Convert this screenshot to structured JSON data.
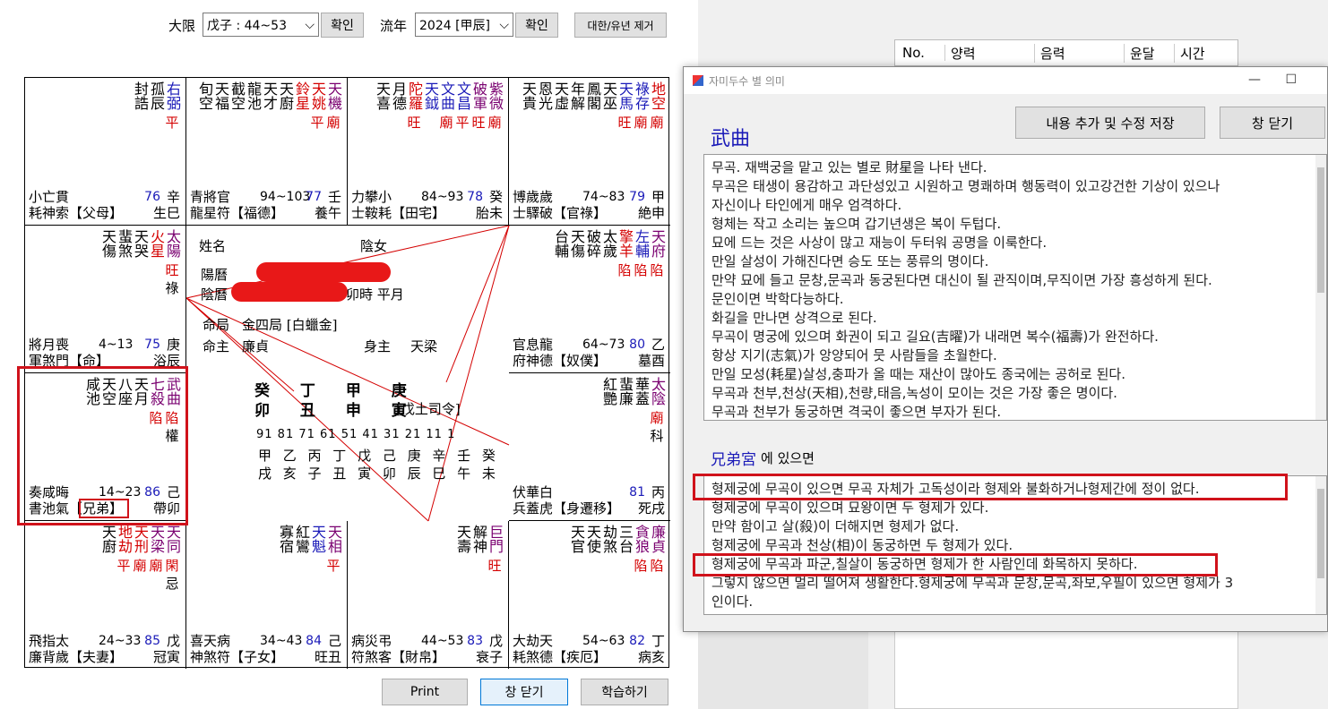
{
  "top": {
    "daehan_label": "大限",
    "daehan_value": "戊子 : 44~53",
    "confirm1": "확인",
    "yunyeon_label": "流年",
    "yunyeon_value": "2024 [甲辰]",
    "confirm2": "확인",
    "remove": "대한/유년 제거"
  },
  "cells": [
    {
      "id": "si",
      "stars": [
        {
          "n": "右弼",
          "c": "blue",
          "st": "平",
          "stc": "red"
        },
        {
          "n": "孤辰",
          "c": "black"
        },
        {
          "n": "封誥",
          "c": "black"
        }
      ],
      "bot_l1": "小亡貫",
      "bot_l2": "耗神索【父母】",
      "age": "",
      "num": "76",
      "gz1": "辛",
      "gz2": "生巳"
    },
    {
      "id": "o",
      "stars": [
        {
          "n": "天機",
          "c": "purple",
          "st": "廟",
          "stc": "red"
        },
        {
          "n": "天姚",
          "c": "red",
          "st": "平",
          "stc": "red"
        },
        {
          "n": "鈴星",
          "c": "red"
        },
        {
          "n": "天廚",
          "c": "black"
        },
        {
          "n": "天才",
          "c": "black"
        },
        {
          "n": "龍池",
          "c": "black"
        },
        {
          "n": "截空",
          "c": "black"
        },
        {
          "n": "天福",
          "c": "black"
        },
        {
          "n": "旬空",
          "c": "black"
        }
      ],
      "bot_l1": "青將官",
      "bot_l2": "龍星符【福德】",
      "age": "94~103",
      "num": "77",
      "gz1": "壬",
      "gz2": "養午"
    },
    {
      "id": "mi",
      "stars": [
        {
          "n": "紫微",
          "c": "purple",
          "st": "廟",
          "stc": "red"
        },
        {
          "n": "破軍",
          "c": "purple",
          "st": "旺",
          "stc": "red"
        },
        {
          "n": "文昌",
          "c": "blue",
          "st": "平",
          "stc": "red"
        },
        {
          "n": "文曲",
          "c": "blue",
          "st": "廟",
          "stc": "red"
        },
        {
          "n": "天鉞",
          "c": "blue"
        },
        {
          "n": "陀羅",
          "c": "red",
          "st": "旺",
          "stc": "red"
        },
        {
          "n": "月德",
          "c": "black"
        },
        {
          "n": "天喜",
          "c": "black"
        }
      ],
      "bot_l1": "力攀小",
      "bot_l2": "士鞍耗【田宅】",
      "age": "84~93",
      "num": "78",
      "gz1": "癸",
      "gz2": "胎未"
    },
    {
      "id": "sin",
      "stars": [
        {
          "n": "地空",
          "c": "red",
          "st": "廟",
          "stc": "red"
        },
        {
          "n": "祿存",
          "c": "blue",
          "st": "廟",
          "stc": "red"
        },
        {
          "n": "天馬",
          "c": "blue",
          "st": "旺",
          "stc": "red"
        },
        {
          "n": "天巫",
          "c": "black"
        },
        {
          "n": "鳳閣",
          "c": "black"
        },
        {
          "n": "年解",
          "c": "black"
        },
        {
          "n": "天虛",
          "c": "black"
        },
        {
          "n": "恩光",
          "c": "black"
        },
        {
          "n": "天貴",
          "c": "black"
        }
      ],
      "bot_l1": "博歲歲",
      "bot_l2": "士驛破【官祿】",
      "age": "74~83",
      "num": "79",
      "gz1": "甲",
      "gz2": "絶申"
    },
    {
      "id": "jin",
      "stars": [
        {
          "n": "太陽",
          "c": "purple",
          "st": "旺",
          "stc": "red",
          "ex": "祿",
          "exc": "black"
        },
        {
          "n": "火星",
          "c": "red"
        },
        {
          "n": "天哭",
          "c": "black"
        },
        {
          "n": "蜚煞",
          "c": "black"
        },
        {
          "n": "天傷",
          "c": "black"
        }
      ],
      "bot_l1": "將月喪",
      "bot_l2": "軍煞門【命】",
      "age": "4~13",
      "num": "75",
      "gz1": "庚",
      "gz2": "浴辰"
    },
    {
      "id": "yu",
      "stars": [
        {
          "n": "天府",
          "c": "purple",
          "st": "陷",
          "stc": "red"
        },
        {
          "n": "左輔",
          "c": "blue",
          "st": "陷",
          "stc": "red"
        },
        {
          "n": "擎羊",
          "c": "red",
          "st": "陷",
          "stc": "red"
        },
        {
          "n": "太歲",
          "c": "black"
        },
        {
          "n": "破碎",
          "c": "black"
        },
        {
          "n": "天傷",
          "c": "black"
        },
        {
          "n": "台輔",
          "c": "black"
        }
      ],
      "bot_l1": "官息龍",
      "bot_l2": "府神德【奴僕】",
      "age": "64~73",
      "num": "80",
      "gz1": "乙",
      "gz2": "墓酉"
    },
    {
      "id": "myo",
      "stars": [
        {
          "n": "武曲",
          "c": "purple",
          "st": "陷",
          "stc": "red",
          "ex": "權",
          "exc": "black"
        },
        {
          "n": "七殺",
          "c": "purple",
          "st": "陷",
          "stc": "red"
        },
        {
          "n": "天月",
          "c": "black"
        },
        {
          "n": "八座",
          "c": "black"
        },
        {
          "n": "天空",
          "c": "black"
        },
        {
          "n": "咸池",
          "c": "black"
        }
      ],
      "bot_l1": "奏咸晦",
      "bot_l2": "書池氣【兄弟】",
      "age": "14~23",
      "num": "86",
      "gz1": "己",
      "gz2": "帶卯"
    },
    {
      "id": "sul",
      "stars": [
        {
          "n": "太陰",
          "c": "purple",
          "st": "廟",
          "stc": "red",
          "ex": "科",
          "exc": "black"
        },
        {
          "n": "華蓋",
          "c": "black"
        },
        {
          "n": "蜚廉",
          "c": "black"
        },
        {
          "n": "紅艷",
          "c": "black"
        }
      ],
      "bot_l1": "伏華白",
      "bot_l2": "兵蓋虎【身遷移】",
      "age": "",
      "num": "81",
      "gz1": "丙",
      "gz2": "死戌"
    },
    {
      "id": "in",
      "stars": [
        {
          "n": "天同",
          "c": "purple",
          "st": "閑",
          "stc": "red",
          "ex": "忌",
          "exc": "black"
        },
        {
          "n": "天梁",
          "c": "purple",
          "st": "廟",
          "stc": "red"
        },
        {
          "n": "天刑",
          "c": "red",
          "st": "廟",
          "stc": "red"
        },
        {
          "n": "地劫",
          "c": "red",
          "st": "平",
          "stc": "red"
        },
        {
          "n": "天廚",
          "c": "black"
        }
      ],
      "bot_l1": "飛指太",
      "bot_l2": "廉背歲【夫妻】",
      "age": "24~33",
      "num": "85",
      "gz1": "戊",
      "gz2": "冠寅"
    },
    {
      "id": "chuk",
      "stars": [
        {
          "n": "天相",
          "c": "purple",
          "st": "平",
          "stc": "red"
        },
        {
          "n": "天魁",
          "c": "blue"
        },
        {
          "n": "紅鸞",
          "c": "black"
        },
        {
          "n": "寡宿",
          "c": "black"
        }
      ],
      "bot_l1": "喜天病",
      "bot_l2": "神煞符【子女】",
      "age": "34~43",
      "num": "84",
      "gz1": "己",
      "gz2": "旺丑"
    },
    {
      "id": "ja",
      "stars": [
        {
          "n": "巨門",
          "c": "purple",
          "st": "旺",
          "stc": "red"
        },
        {
          "n": "解神",
          "c": "black"
        },
        {
          "n": "天壽",
          "c": "black"
        }
      ],
      "bot_l1": "病災弔",
      "bot_l2": "符煞客【財帛】",
      "age": "44~53",
      "num": "83",
      "gz1": "戊",
      "gz2": "衰子"
    },
    {
      "id": "hae",
      "stars": [
        {
          "n": "廉貞",
          "c": "purple",
          "st": "陷",
          "stc": "red"
        },
        {
          "n": "貪狼",
          "c": "purple",
          "st": "陷",
          "stc": "red"
        },
        {
          "n": "三台",
          "c": "black"
        },
        {
          "n": "劫煞",
          "c": "black"
        },
        {
          "n": "天使",
          "c": "black"
        },
        {
          "n": "天官",
          "c": "black"
        }
      ],
      "bot_l1": "大劫天",
      "bot_l2": "耗煞德【疾厄】",
      "age": "54~63",
      "num": "82",
      "gz1": "丁",
      "gz2": "病亥"
    }
  ],
  "center": {
    "name_label": "姓名",
    "gender": "陰女",
    "yang_label": "陽曆",
    "eum_label": "陰曆",
    "time_text": "卯時 平月",
    "myeongguk_label": "命局",
    "myeongguk": "金四局 [白蠟金]",
    "myeongju_label": "命主",
    "myeongju": "廉貞",
    "sinju_label": "身主",
    "sinju": "天梁",
    "pillars_top": "癸 丁 甲 庚",
    "pillars_bot": "卯 丑 申 寅",
    "saryeong": "[戊土司令]",
    "dw_ages": "91 81 71 61 51 41 31 21 11 1",
    "dw_top": "甲 乙 丙 丁 戊 己 庚 辛 壬 癸",
    "dw_bot": "戌 亥 子 丑 寅 卯 辰 巳 午 未"
  },
  "bottom_buttons": {
    "print": "Print",
    "close": "창 닫기",
    "learn": "학습하기"
  },
  "right_table": {
    "cols": [
      "No.",
      "양력",
      "음력",
      "윤달",
      "시간"
    ]
  },
  "dialog": {
    "title": "자미두수 별 의미",
    "save": "내용 추가 및 수정 저장",
    "close": "창 닫기",
    "star": "武曲",
    "lines": [
      "무곡. 재백궁을 맡고 있는 별로 財星을 나타 낸다.",
      "무곡은 태생이 용감하고 과단성있고 시원하고 명쾌하며 행동력이 있고강건한 기상이 있으나",
      "자신이나 타인에게 매우 엄격하다.",
      "형체는 작고 소리는 높으며 갑기년생은 복이 두텁다.",
      "묘에 드는 것은 사상이 많고 재능이 두터워 공명을 이룩한다.",
      "만일 살성이 가해진다면 승도 또는 풍류의 명이다.",
      "만약 묘에 들고 문창,문곡과 동궁된다면 대신이 될 관직이며,무직이면 가장 흥성하게 된다.",
      "문인이면 박학다능하다.",
      "화길을 만나면 상격으로 된다.",
      "무곡이 명궁에 있으며 화권이 되고 길요(吉曜)가 내래면 복수(福壽)가 완전하다.",
      "항상 지기(志氣)가 앙양되어 뭇 사람들을 초월한다.",
      "만일 모성(耗星)살성,충파가 올 때는 재산이 많아도 종국에는 공허로 된다.",
      "무곡과 천부,천상(天相),천량,태음,녹성이 모이는 것은 가장 좋은 명이다.",
      "무곡과 천부가 동궁하면 격국이 좋으면 부자가 된다."
    ],
    "palace": "兄弟宮",
    "palace_suffix": " 에 있으면",
    "palace_lines": [
      "형제궁에 무곡이 있으면 무곡 자체가 고독성이라 형제와 불화하거나형제간에 정이 없다.",
      "형제궁에 무곡이 있으며 묘왕이면 두 형제가 있다.",
      "만약 함이고 살(殺)이 더해지면 형제가 없다.",
      "형제궁에 무곡과 천상(相)이 동궁하면 두 형제가 있다.",
      "형제궁에 무곡과 파군,칠살이 동궁하면 형제가 한 사람인데 화목하지 못하다.",
      "그렇지 않으면 멀리 떨어져 생활한다.형제궁에 무곡과 문창,문곡,좌보,우필이 있으면 형제가 3",
      "인이다."
    ]
  }
}
